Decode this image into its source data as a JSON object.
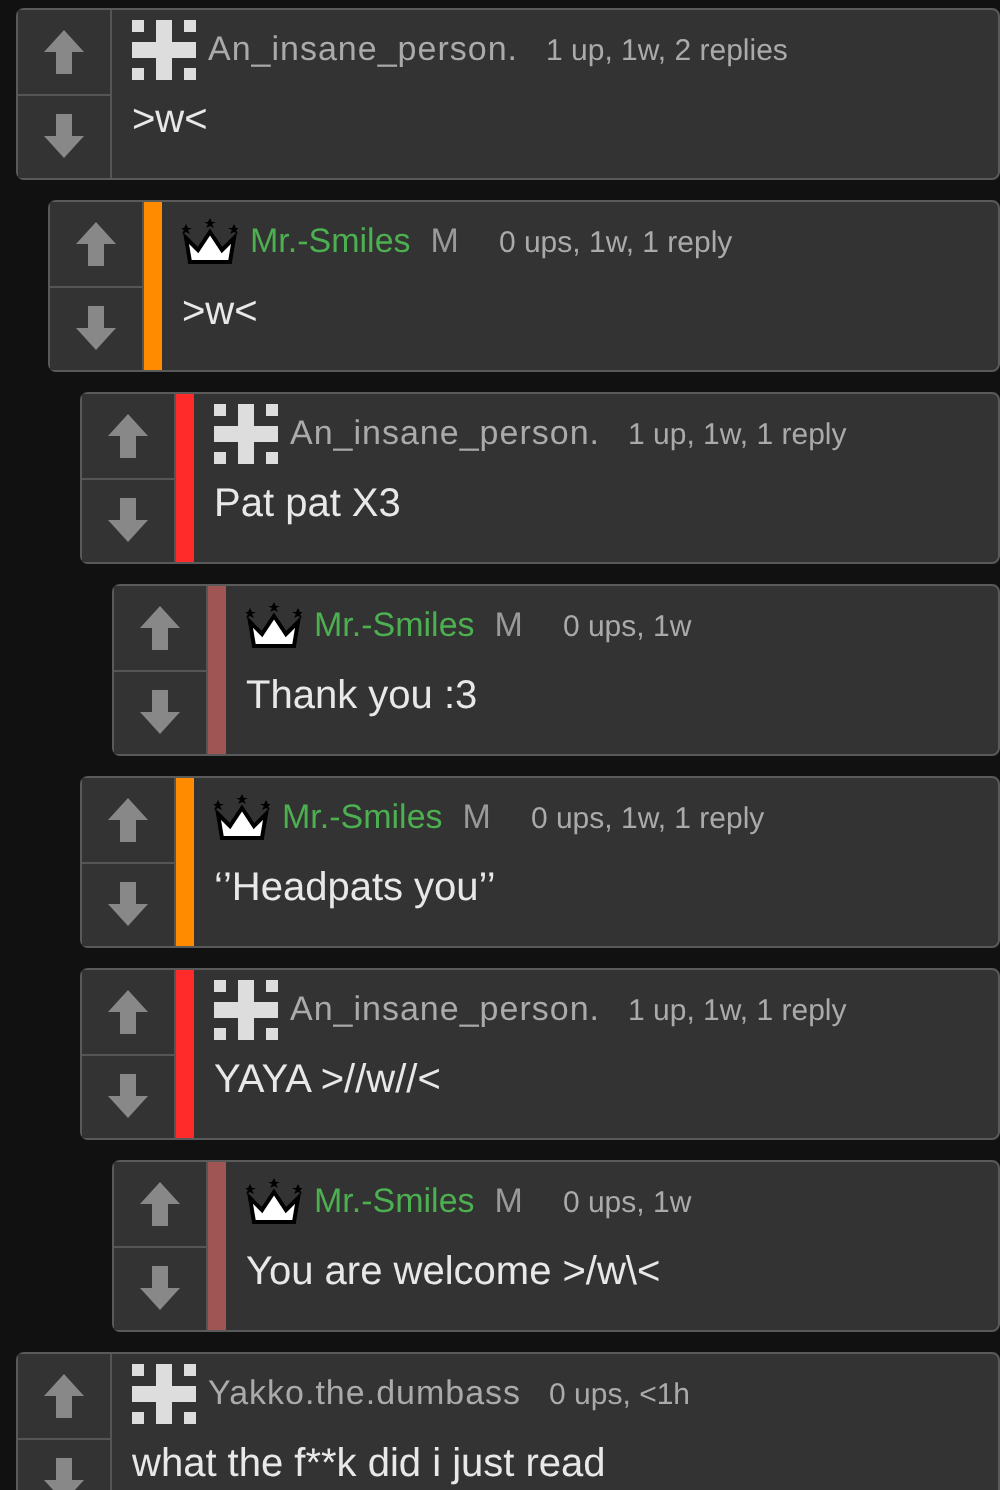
{
  "comments": [
    {
      "kind": "grid",
      "author": "An_insane_person.",
      "mod": false,
      "meta": "1 up, 1w, 2 replies",
      "text": ">w<",
      "children": [
        {
          "kind": "crown",
          "author": "Mr.-Smiles",
          "mod": true,
          "badge": "M",
          "meta": "0 ups, 1w, 1 reply",
          "text": ">w<",
          "color": "#ff8c00",
          "children": [
            {
              "kind": "grid",
              "author": "An_insane_person.",
              "mod": false,
              "meta": "1 up, 1w, 1 reply",
              "text": "Pat pat X3",
              "color": "#ff2a2a",
              "children": [
                {
                  "kind": "crown",
                  "author": "Mr.-Smiles",
                  "mod": true,
                  "badge": "M",
                  "meta": "0 ups, 1w",
                  "text": "Thank you :3",
                  "color": "#a05555"
                }
              ]
            },
            {
              "kind": "crown",
              "author": "Mr.-Smiles",
              "mod": true,
              "badge": "M",
              "meta": "0 ups, 1w, 1 reply",
              "text": "‘’Headpats you’’",
              "color": "#ff8c00"
            },
            {
              "kind": "grid",
              "author": "An_insane_person.",
              "mod": false,
              "meta": "1 up, 1w, 1 reply",
              "text": "YAYA >//w//<",
              "color": "#ff2a2a",
              "children": [
                {
                  "kind": "crown",
                  "author": "Mr.-Smiles",
                  "mod": true,
                  "badge": "M",
                  "meta": "0 ups, 1w",
                  "text": "You are welcome >/w\\<",
                  "color": "#a05555"
                }
              ]
            }
          ]
        }
      ]
    },
    {
      "kind": "grid",
      "author": "Yakko.the.dumbass",
      "mod": false,
      "meta": "0 ups, <1h",
      "text": "what the f**k did i just read"
    }
  ]
}
